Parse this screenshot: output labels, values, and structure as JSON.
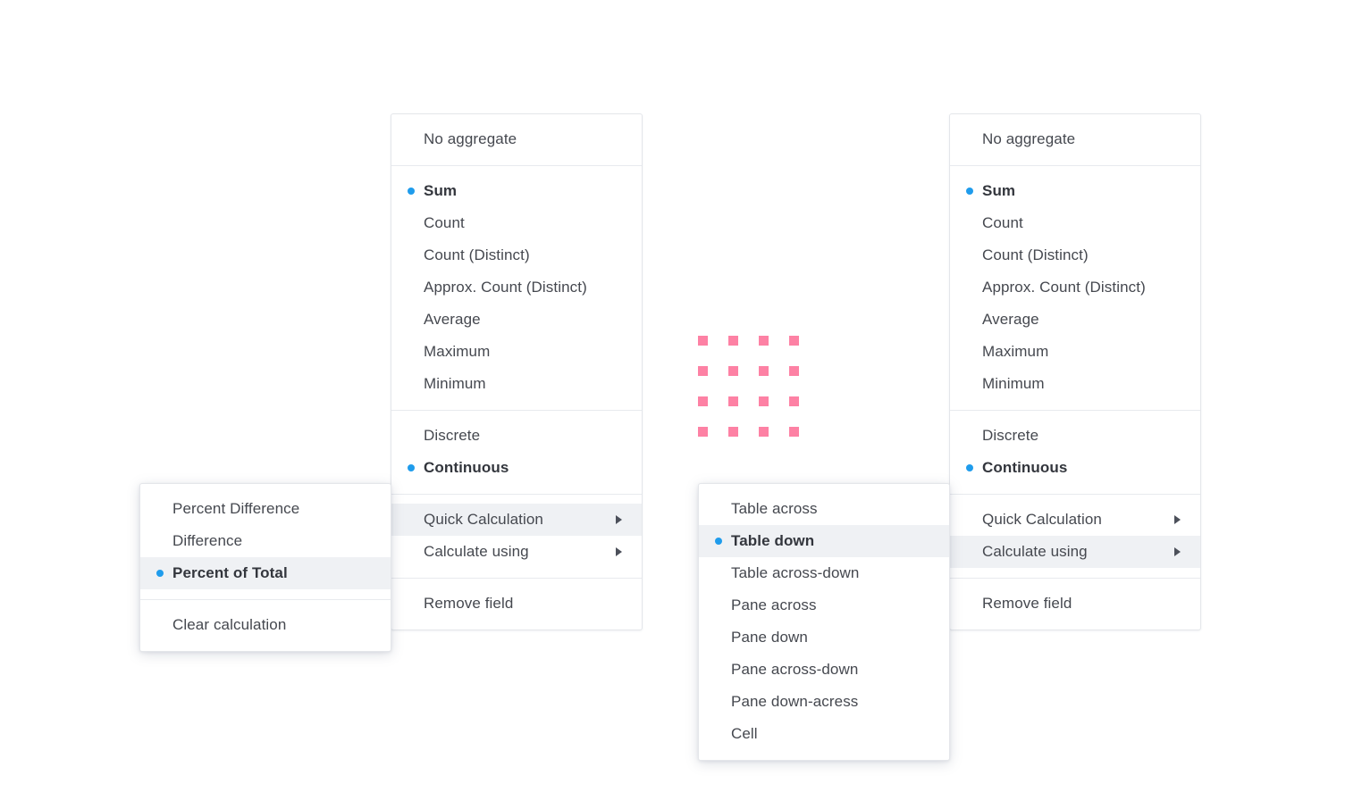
{
  "colors": {
    "accent_blue": "#1f9cec",
    "highlight_row": "#eff1f4",
    "text": "#45484f",
    "panel_border": "#e4e6ea",
    "dot_pink": "#fd81a4"
  },
  "dot_grid": {
    "name": "pink-dot-grid",
    "rows": 4,
    "columns": 4,
    "color": "#fd81a4"
  },
  "menus": {
    "aggregate_left": {
      "sections": [
        {
          "items": [
            {
              "label": "No aggregate",
              "selected": false,
              "highlighted": false,
              "submenu": false
            }
          ]
        },
        {
          "items": [
            {
              "label": "Sum",
              "selected": true,
              "highlighted": false,
              "submenu": false
            },
            {
              "label": "Count",
              "selected": false,
              "highlighted": false,
              "submenu": false
            },
            {
              "label": "Count (Distinct)",
              "selected": false,
              "highlighted": false,
              "submenu": false
            },
            {
              "label": "Approx. Count (Distinct)",
              "selected": false,
              "highlighted": false,
              "submenu": false
            },
            {
              "label": "Average",
              "selected": false,
              "highlighted": false,
              "submenu": false
            },
            {
              "label": "Maximum",
              "selected": false,
              "highlighted": false,
              "submenu": false
            },
            {
              "label": "Minimum",
              "selected": false,
              "highlighted": false,
              "submenu": false
            }
          ]
        },
        {
          "items": [
            {
              "label": "Discrete",
              "selected": false,
              "highlighted": false,
              "submenu": false
            },
            {
              "label": "Continuous",
              "selected": true,
              "highlighted": false,
              "submenu": false
            }
          ]
        },
        {
          "items": [
            {
              "label": "Quick Calculation",
              "selected": false,
              "highlighted": true,
              "submenu": true
            },
            {
              "label": "Calculate using",
              "selected": false,
              "highlighted": false,
              "submenu": true
            }
          ]
        },
        {
          "items": [
            {
              "label": "Remove field",
              "selected": false,
              "highlighted": false,
              "submenu": false
            }
          ]
        }
      ]
    },
    "aggregate_right": {
      "sections": [
        {
          "items": [
            {
              "label": "No aggregate",
              "selected": false,
              "highlighted": false,
              "submenu": false
            }
          ]
        },
        {
          "items": [
            {
              "label": "Sum",
              "selected": true,
              "highlighted": false,
              "submenu": false
            },
            {
              "label": "Count",
              "selected": false,
              "highlighted": false,
              "submenu": false
            },
            {
              "label": "Count (Distinct)",
              "selected": false,
              "highlighted": false,
              "submenu": false
            },
            {
              "label": "Approx. Count (Distinct)",
              "selected": false,
              "highlighted": false,
              "submenu": false
            },
            {
              "label": "Average",
              "selected": false,
              "highlighted": false,
              "submenu": false
            },
            {
              "label": "Maximum",
              "selected": false,
              "highlighted": false,
              "submenu": false
            },
            {
              "label": "Minimum",
              "selected": false,
              "highlighted": false,
              "submenu": false
            }
          ]
        },
        {
          "items": [
            {
              "label": "Discrete",
              "selected": false,
              "highlighted": false,
              "submenu": false
            },
            {
              "label": "Continuous",
              "selected": true,
              "highlighted": false,
              "submenu": false
            }
          ]
        },
        {
          "items": [
            {
              "label": "Quick Calculation",
              "selected": false,
              "highlighted": false,
              "submenu": true
            },
            {
              "label": "Calculate using",
              "selected": false,
              "highlighted": true,
              "submenu": true
            }
          ]
        },
        {
          "items": [
            {
              "label": "Remove field",
              "selected": false,
              "highlighted": false,
              "submenu": false
            }
          ]
        }
      ]
    },
    "quick_calculation_submenu": {
      "sections": [
        {
          "items": [
            {
              "label": "Percent Difference",
              "selected": false,
              "highlighted": false,
              "submenu": false
            },
            {
              "label": "Difference",
              "selected": false,
              "highlighted": false,
              "submenu": false
            },
            {
              "label": "Percent of Total",
              "selected": true,
              "highlighted": true,
              "submenu": false
            }
          ]
        },
        {
          "items": [
            {
              "label": "Clear calculation",
              "selected": false,
              "highlighted": false,
              "submenu": false
            }
          ]
        }
      ]
    },
    "calculate_using_submenu": {
      "sections": [
        {
          "items": [
            {
              "label": "Table across",
              "selected": false,
              "highlighted": false,
              "submenu": false
            },
            {
              "label": "Table down",
              "selected": true,
              "highlighted": true,
              "submenu": false
            },
            {
              "label": "Table across-down",
              "selected": false,
              "highlighted": false,
              "submenu": false
            },
            {
              "label": "Pane across",
              "selected": false,
              "highlighted": false,
              "submenu": false
            },
            {
              "label": "Pane down",
              "selected": false,
              "highlighted": false,
              "submenu": false
            },
            {
              "label": "Pane across-down",
              "selected": false,
              "highlighted": false,
              "submenu": false
            },
            {
              "label": "Pane down-acress",
              "selected": false,
              "highlighted": false,
              "submenu": false
            },
            {
              "label": "Cell",
              "selected": false,
              "highlighted": false,
              "submenu": false
            }
          ]
        }
      ]
    }
  }
}
